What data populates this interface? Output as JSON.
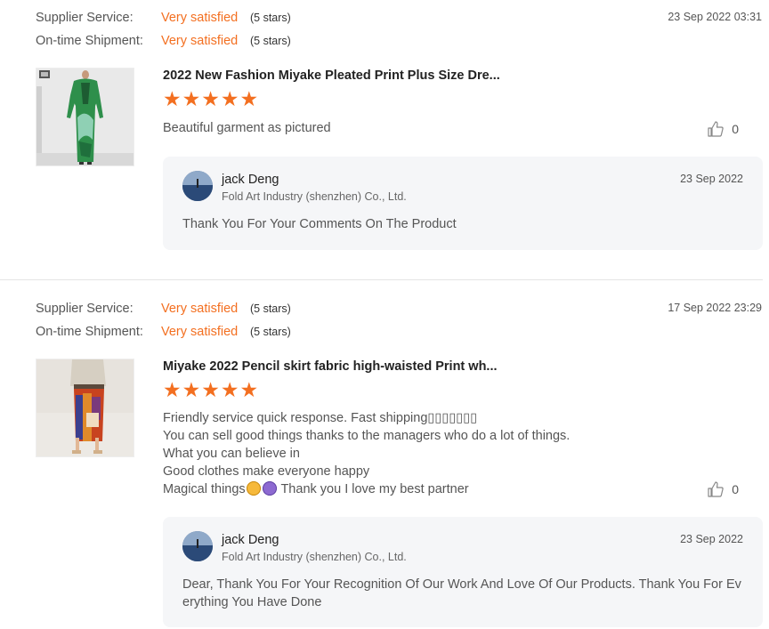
{
  "reviews": [
    {
      "supplier_label": "Supplier Service:",
      "supplier_value": "Very satisfied",
      "supplier_stars_note": "(5 stars)",
      "shipment_label": "On-time Shipment:",
      "shipment_value": "Very satisfied",
      "shipment_stars_note": "(5 stars)",
      "date": "23 Sep 2022 03:31",
      "product_title": "2022 New Fashion Miyake Pleated Print Plus Size Dre...",
      "product_rating": 5,
      "comment_lines": [
        "Beautiful garment as pictured"
      ],
      "likes": "0",
      "reply": {
        "name": "jack Deng",
        "company": "Fold Art Industry (shenzhen) Co., Ltd.",
        "date": "23 Sep 2022",
        "text": "Thank You For Your Comments On The Product"
      }
    },
    {
      "supplier_label": "Supplier Service:",
      "supplier_value": "Very satisfied",
      "supplier_stars_note": "(5 stars)",
      "shipment_label": "On-time Shipment:",
      "shipment_value": "Very satisfied",
      "shipment_stars_note": "(5 stars)",
      "date": "17 Sep 2022 23:29",
      "product_title": "Miyake 2022 Pencil skirt fabric high-waisted Print wh...",
      "product_rating": 5,
      "comment_lines": [
        "Friendly service quick response. Fast shipping▯▯▯▯▯▯▯",
        "You can sell good things thanks to the managers who do a lot of things.",
        "What you can believe in",
        "Good clothes make everyone happy",
        "Magical things"
      ],
      "comment_tail": " Thank you I love my best partner",
      "emojis": [
        "star-struck-emoji",
        "person-gesturing-emoji"
      ],
      "likes": "0",
      "reply": {
        "name": "jack Deng",
        "company": "Fold Art Industry (shenzhen) Co., Ltd.",
        "date": "23 Sep 2022",
        "text": "Dear, Thank You For Your Recognition Of Our Work And Love Of Our Products. Thank You For Everything You Have Done"
      }
    }
  ],
  "colors": {
    "accent": "#f36f20",
    "reply_bg": "#f5f6f8",
    "divider": "#e4e4e4"
  },
  "icons": {
    "like": "thumbs-up-icon",
    "star": "star-icon"
  }
}
